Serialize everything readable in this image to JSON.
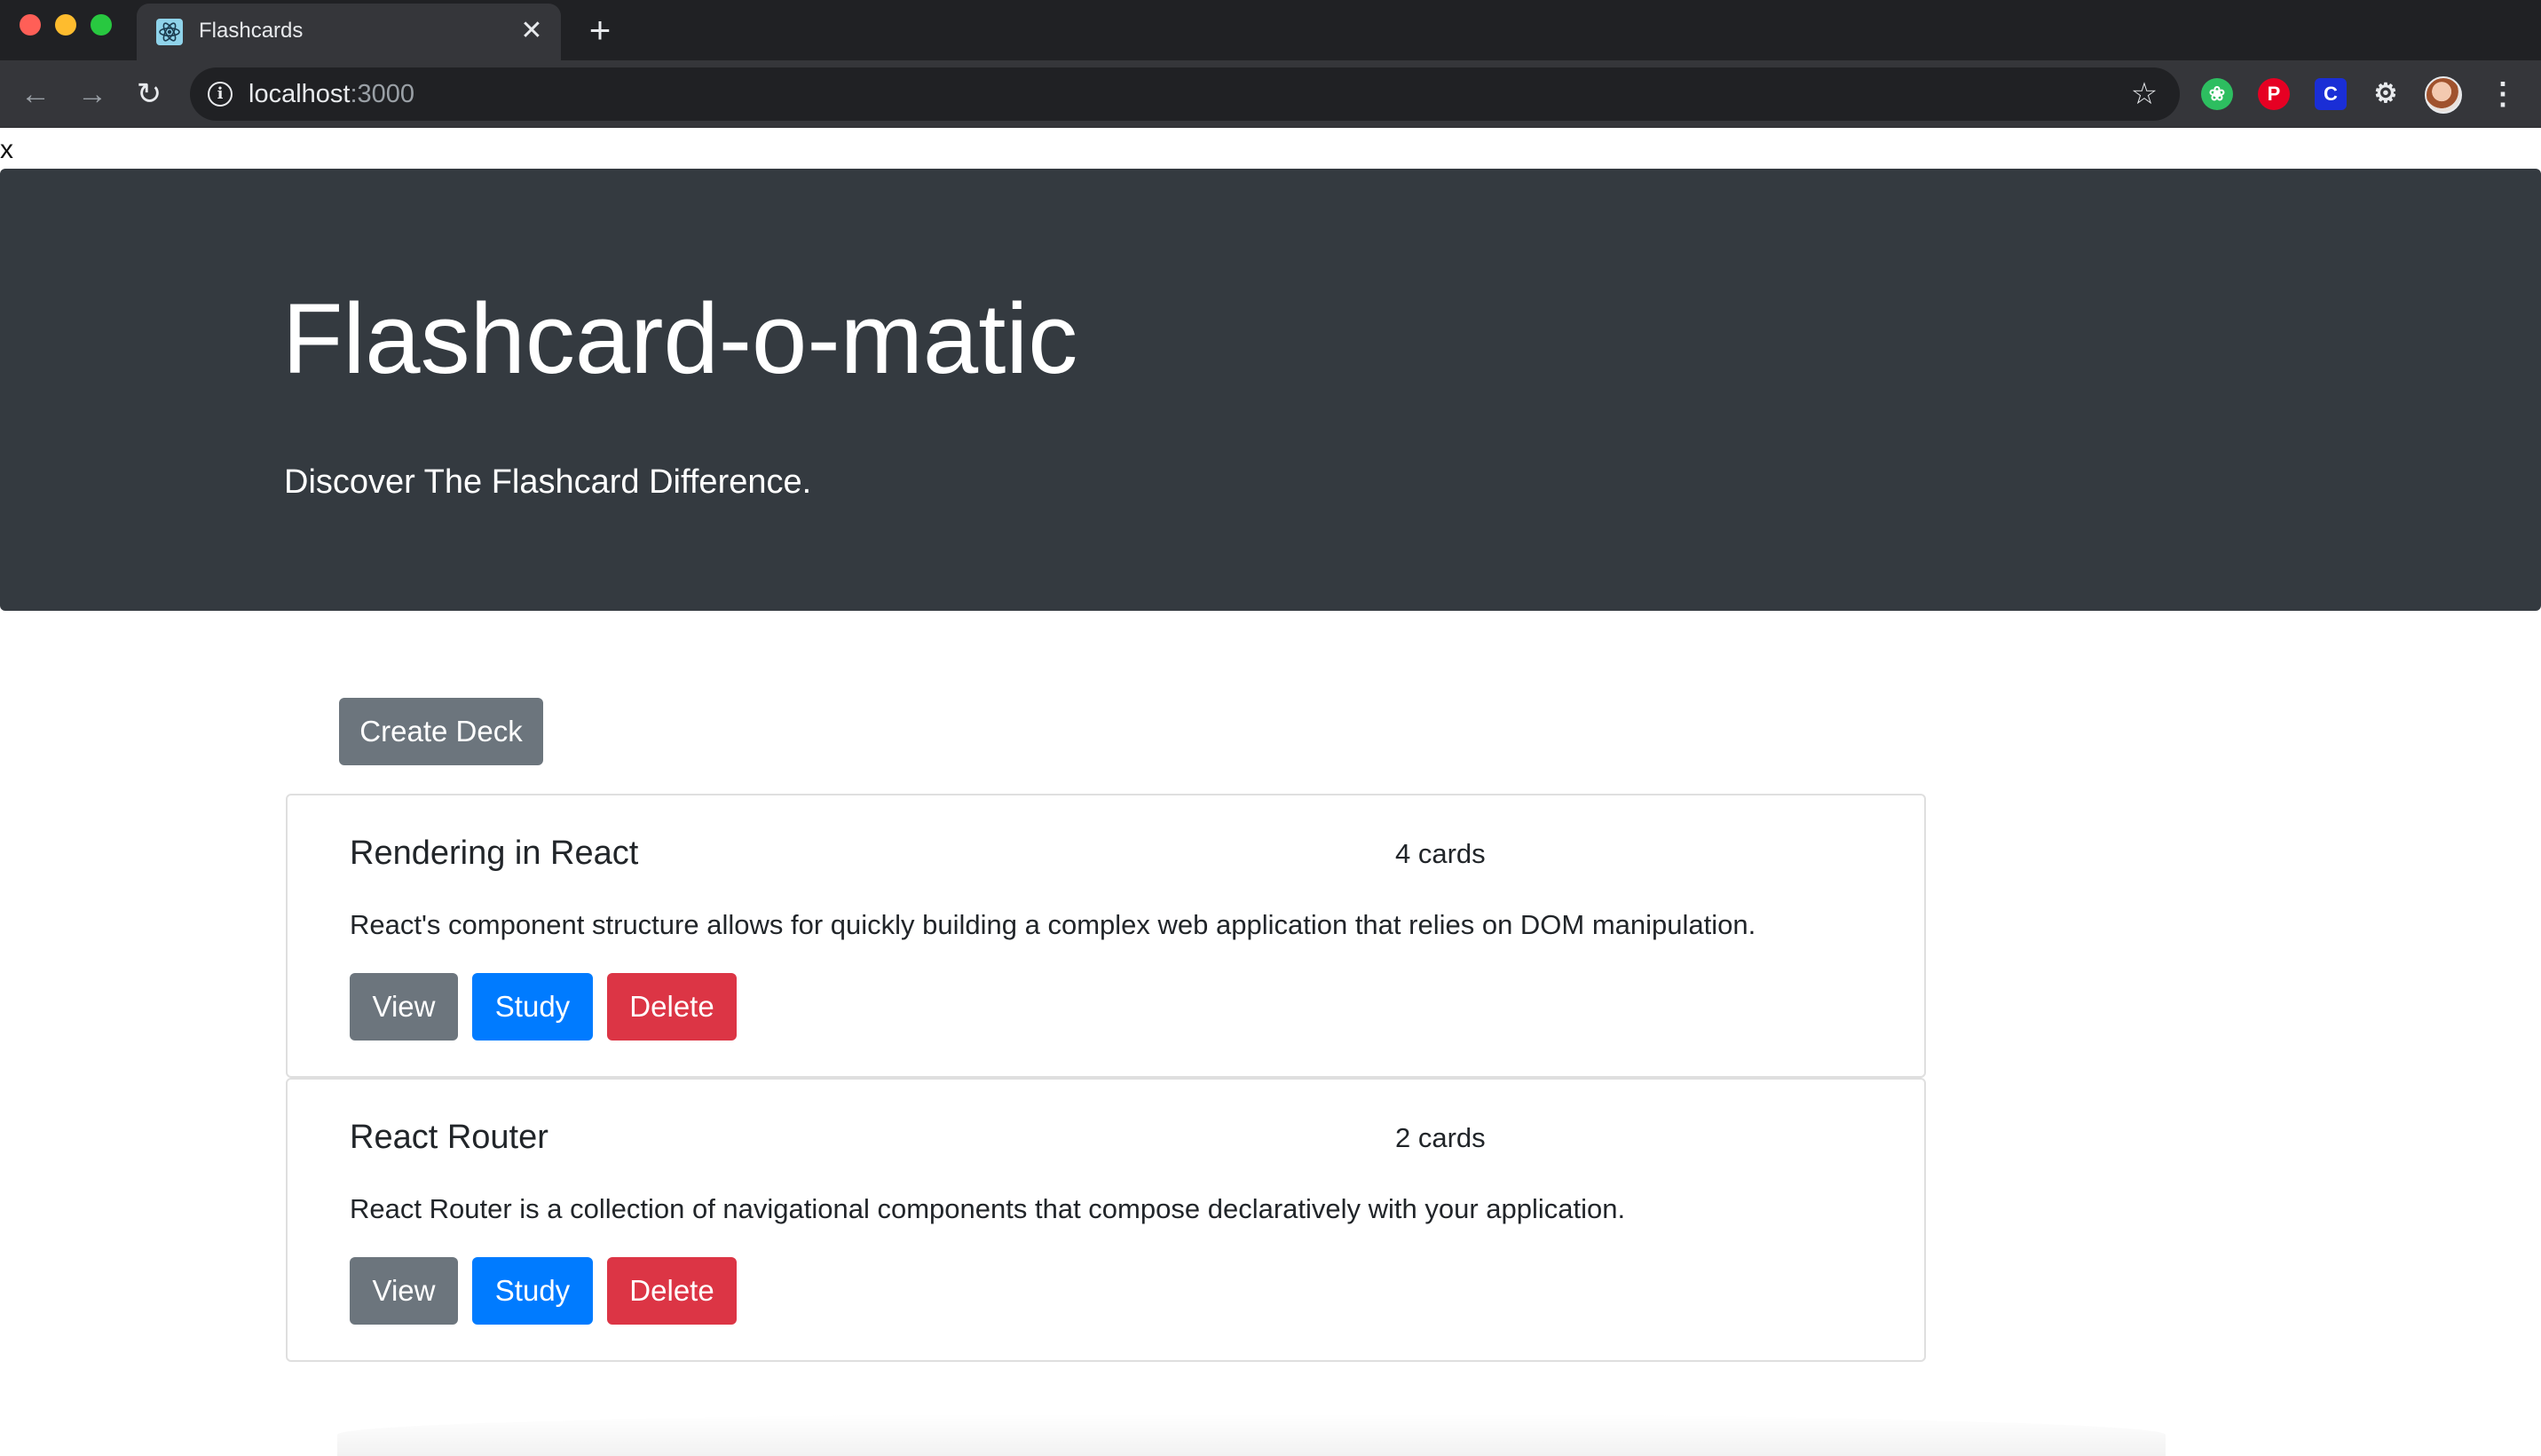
{
  "browser": {
    "tab_title": "Flashcards",
    "tab_close": "✕",
    "new_tab": "+",
    "url_host": "localhost",
    "url_port": ":3000",
    "icons": [
      "back-icon",
      "forward-icon",
      "reload-icon",
      "info-icon",
      "star-icon",
      "evernote-icon",
      "pinterest-icon",
      "c-extension-icon",
      "puzzle-icon",
      "avatar",
      "menu-icon"
    ],
    "ext_c_label": "C"
  },
  "page": {
    "stray_text": "x",
    "jumbotron": {
      "title": "Flashcard-o-matic",
      "lead": "Discover The Flashcard Difference."
    },
    "create_deck_label": "Create Deck",
    "decks": [
      {
        "name": "Rendering in React",
        "count": "4 cards",
        "description": "React's component structure allows for quickly building a complex web application that relies on DOM manipulation.",
        "view_label": "View",
        "study_label": "Study",
        "delete_label": "Delete"
      },
      {
        "name": "React Router",
        "count": "2 cards",
        "description": "React Router is a collection of navigational components that compose declaratively with your application.",
        "view_label": "View",
        "study_label": "Study",
        "delete_label": "Delete"
      }
    ]
  },
  "colors": {
    "jumbotron_bg": "#343a40",
    "secondary": "#6c757d",
    "primary": "#007bff",
    "danger": "#dc3545"
  }
}
